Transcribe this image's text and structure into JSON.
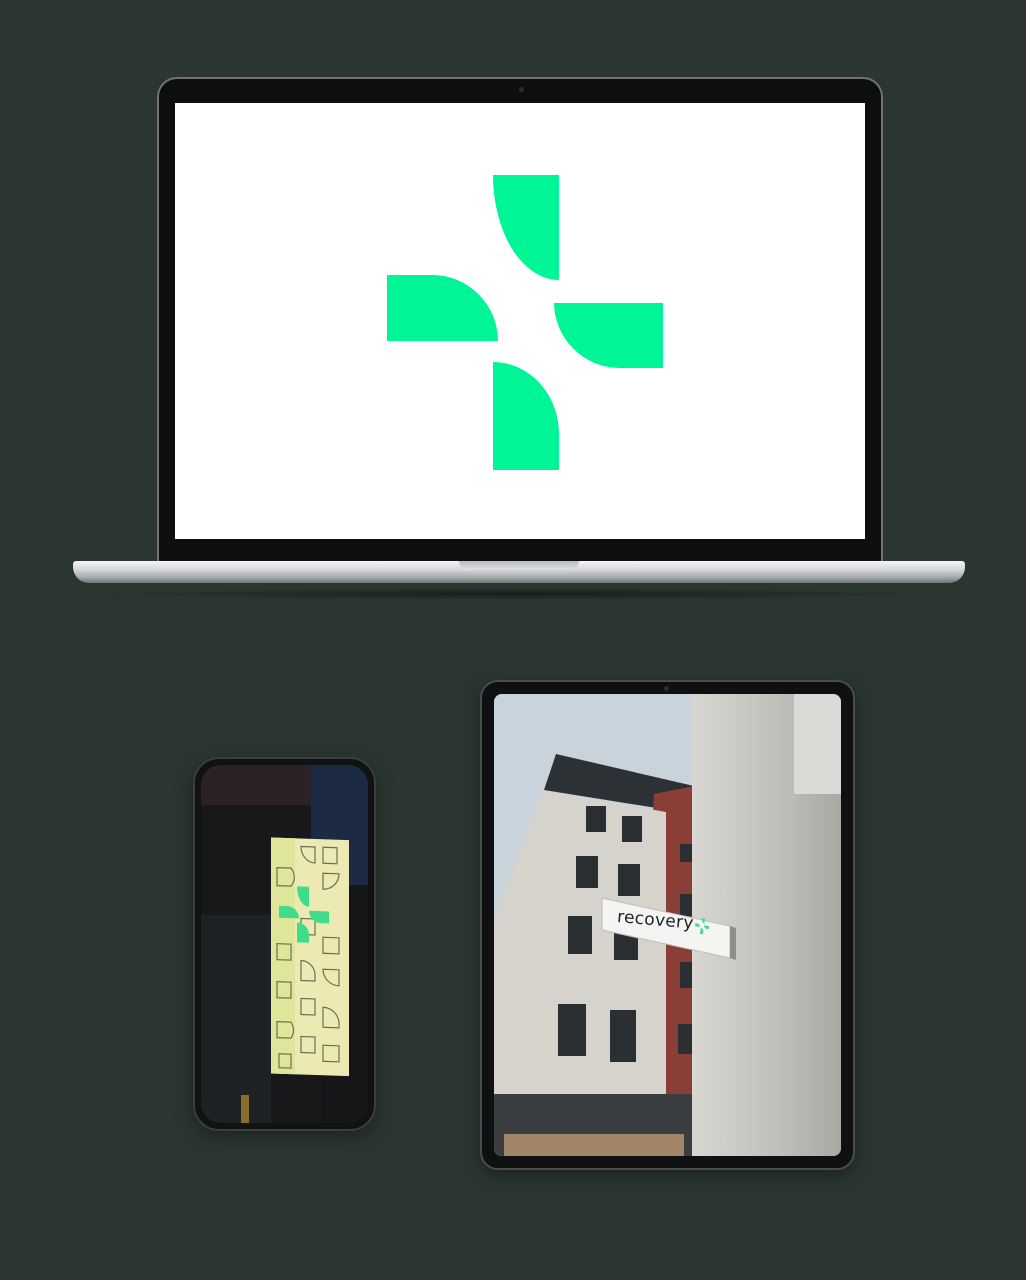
{
  "colors": {
    "background": "#2b3631",
    "brand_green": "#00f596",
    "sign_green": "#3fdc8b"
  },
  "laptop": {
    "screen_content": "recovery-cross-logo-icon"
  },
  "phone": {
    "screen_content": "illuminated-lightbox-sign-photo"
  },
  "tablet": {
    "screen_content": "building-facade-photo",
    "sign_text": "recovery"
  }
}
